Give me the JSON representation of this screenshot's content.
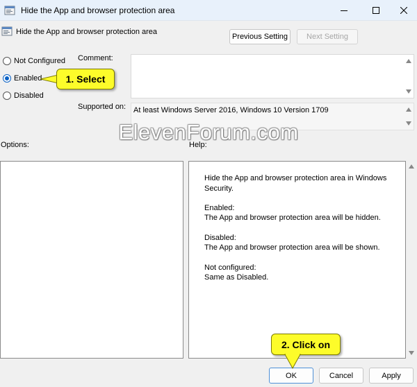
{
  "window": {
    "title": "Hide the App and browser protection area",
    "minimize_icon": "minimize-icon",
    "maximize_icon": "maximize-icon",
    "close_icon": "close-icon"
  },
  "header": {
    "setting_name": "Hide the App and browser protection area",
    "previous_label": "Previous Setting",
    "next_label": "Next Setting"
  },
  "state": {
    "options": [
      {
        "label": "Not Configured",
        "selected": false
      },
      {
        "label": "Enabled",
        "selected": true
      },
      {
        "label": "Disabled",
        "selected": false
      }
    ]
  },
  "comment": {
    "label": "Comment:",
    "value": ""
  },
  "supported": {
    "label": "Supported on:",
    "value": "At least Windows Server 2016, Windows 10 Version 1709"
  },
  "options_pane": {
    "label": "Options:"
  },
  "help_pane": {
    "label": "Help:",
    "paragraphs": [
      "Hide the App and browser protection area in Windows Security.",
      "Enabled:",
      "The App and browser protection area will be hidden.",
      "Disabled:",
      "The App and browser protection area will be shown.",
      "Not configured:",
      "Same as Disabled."
    ]
  },
  "footer": {
    "ok_label": "OK",
    "cancel_label": "Cancel",
    "apply_label": "Apply"
  },
  "callouts": {
    "select": "1. Select",
    "click": "2. Click on"
  },
  "watermark": "ElevenForum.com",
  "colors": {
    "accent": "#0a61c5",
    "callout": "#fdfc2a",
    "titlebar": "#e8f1fb"
  }
}
